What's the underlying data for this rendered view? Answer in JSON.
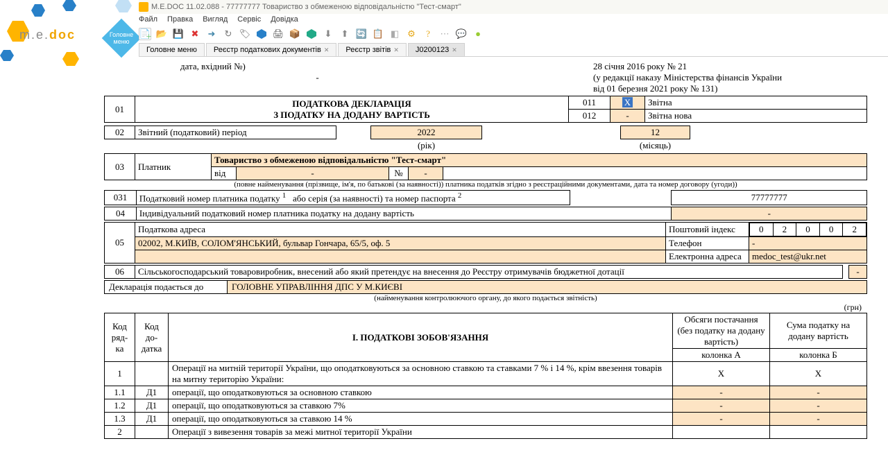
{
  "title": "M.E.DOC 11.02.088  - 77777777 Товариство з обмеженою відповідальністю \"Тест-смарт\"",
  "menu": [
    "Файл",
    "Правка",
    "Вигляд",
    "Сервіс",
    "Довідка"
  ],
  "mainmenu_label": "Головне меню",
  "tabs": [
    {
      "label": "Головне меню",
      "closable": false
    },
    {
      "label": "Реєстр податкових документів",
      "closable": true
    },
    {
      "label": "Реєстр звітів",
      "closable": true
    },
    {
      "label": "J0200123",
      "closable": true,
      "active": true
    }
  ],
  "top": {
    "date_in": "дата, вхідний №)",
    "date1": "28 січня  2016 року № 21",
    "red": "(у редакції наказу Міністерства фінансів України",
    "red2": "від 01 березня 2021 року № 131)"
  },
  "h1": {
    "code": "01",
    "t1": "ПОДАТКОВА ДЕКЛАРАЦІЯ",
    "t2": "З ПОДАТКУ НА ДОДАНУ ВАРТІСТЬ",
    "c011": "011",
    "c012": "012",
    "x": "X",
    "dash": "-",
    "l011": "Звітна",
    "l012": "Звітна нова"
  },
  "r02": {
    "code": "02",
    "label": "Звітний (податковий) період",
    "year": "2022",
    "ylabel": "(рік)",
    "month": "12",
    "mlabel": "(місяць)"
  },
  "r03": {
    "code": "03",
    "p": "Платник",
    "name": "Товариство з обмеженою відповідальністю \"Тест-смарт\"",
    "vid": "від",
    "dash": "-",
    "no": "№",
    "dash2": "-",
    "note": "(повне найменування (прізвище, ім'я, по батькові (за наявності)) платника податків згідно з реєстраційними документами, дата та номер договору (угоди))"
  },
  "r031": {
    "code": "031",
    "label": "Податковий номер платника податку",
    "sup1": "1",
    "label2": "або серія (за наявності) та номер паспорта",
    "sup2": "2",
    "val": "77777777"
  },
  "r04": {
    "code": "04",
    "label": "Індивідуальний податковий номер платника податку на додану вартість",
    "val": "-"
  },
  "r05": {
    "code": "05",
    "label": "Податкова адреса",
    "addr": "02002, М.КИЇВ, СОЛОМ'ЯНСЬКИЙ, бульвар Гончара, 65/5, оф. 5",
    "post": "Поштовий індекс",
    "idx": [
      "0",
      "2",
      "0",
      "0",
      "2"
    ],
    "tel": "Телефон",
    "tval": "-",
    "email": "Електронна адреса",
    "eval": "medoc_test@ukr.net"
  },
  "r06": {
    "code": "06",
    "label": "Сільськогосподарський товаровиробник, внесений або який претендує на внесення до Реєстру отримувачів бюджетної дотації",
    "val": "-"
  },
  "declto": {
    "l": "Декларація подається до",
    "v": "ГОЛОВНЕ УПРАВЛІННЯ ДПС У М.КИЄВІ",
    "note": "(найменування контролюючого органу, до якого подається звітність)"
  },
  "grn": "(грн)",
  "ob": {
    "kr": "Код ряд-ка",
    "kd": "Код до-датка",
    "title": "І. ПОДАТКОВІ ЗОБОВ'ЯЗАННЯ",
    "ah": "Обсяги постачання (без податку на додану вартість)",
    "bh": "Сума податку на додану вартість",
    "ka": "колонка А",
    "kb": "колонка Б",
    "rows": [
      {
        "n": "1",
        "d": "",
        "t": "Операції на митній території України, що оподатковуються за основною ставкою та ставками 7 % і 14 %, крім ввезення товарів на митну територію України:",
        "a": "Х",
        "b": "Х"
      },
      {
        "n": "1.1",
        "d": "Д1",
        "t": "операції, що оподатковуються за основною ставкою",
        "a": "-",
        "b": "-"
      },
      {
        "n": "1.2",
        "d": "Д1",
        "t": "операції, що оподатковуються за ставкою 7%",
        "a": "-",
        "b": "-"
      },
      {
        "n": "1.3",
        "d": "Д1",
        "t": "операції, що оподатковуються за ставкою 14 %",
        "a": "-",
        "b": "-"
      },
      {
        "n": "2",
        "d": "",
        "t": "Операції з вивезення товарів за межі митної території України",
        "a": "",
        "b": ""
      }
    ]
  }
}
